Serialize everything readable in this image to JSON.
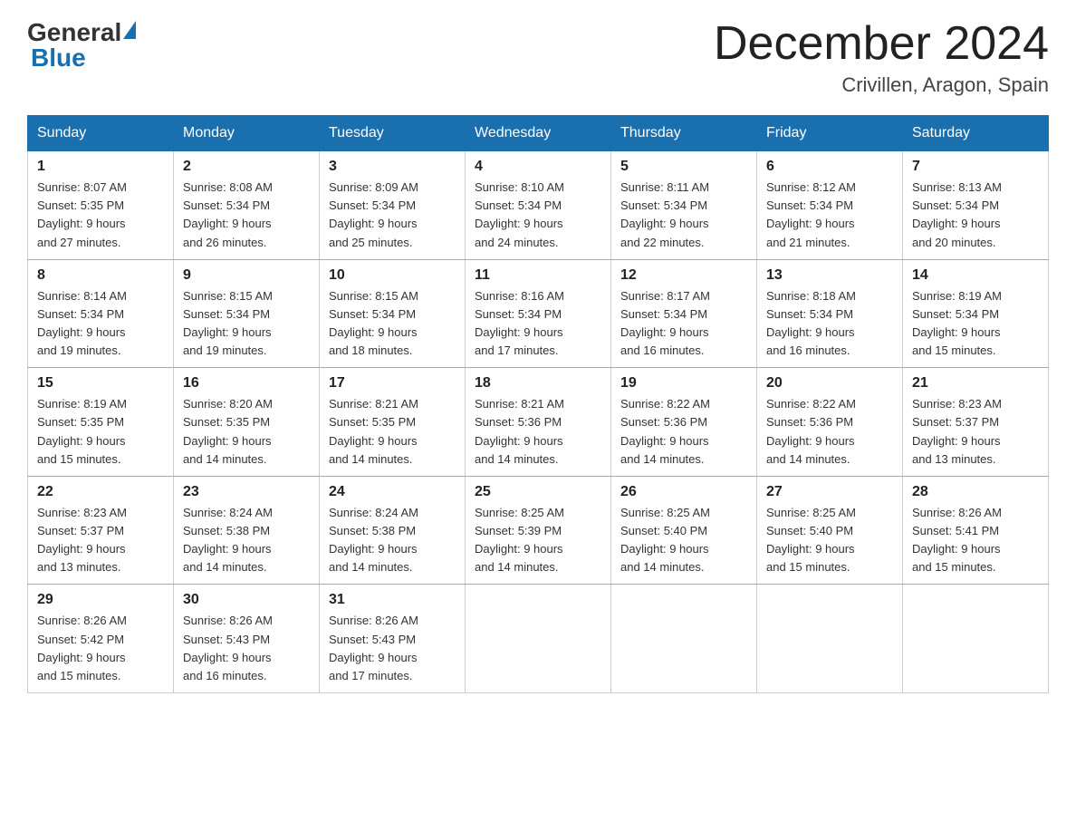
{
  "header": {
    "logo_general": "General",
    "logo_blue": "Blue",
    "month_title": "December 2024",
    "location": "Crivillen, Aragon, Spain"
  },
  "weekdays": [
    "Sunday",
    "Monday",
    "Tuesday",
    "Wednesday",
    "Thursday",
    "Friday",
    "Saturday"
  ],
  "weeks": [
    [
      {
        "day": "1",
        "sunrise": "8:07 AM",
        "sunset": "5:35 PM",
        "daylight": "9 hours and 27 minutes."
      },
      {
        "day": "2",
        "sunrise": "8:08 AM",
        "sunset": "5:34 PM",
        "daylight": "9 hours and 26 minutes."
      },
      {
        "day": "3",
        "sunrise": "8:09 AM",
        "sunset": "5:34 PM",
        "daylight": "9 hours and 25 minutes."
      },
      {
        "day": "4",
        "sunrise": "8:10 AM",
        "sunset": "5:34 PM",
        "daylight": "9 hours and 24 minutes."
      },
      {
        "day": "5",
        "sunrise": "8:11 AM",
        "sunset": "5:34 PM",
        "daylight": "9 hours and 22 minutes."
      },
      {
        "day": "6",
        "sunrise": "8:12 AM",
        "sunset": "5:34 PM",
        "daylight": "9 hours and 21 minutes."
      },
      {
        "day": "7",
        "sunrise": "8:13 AM",
        "sunset": "5:34 PM",
        "daylight": "9 hours and 20 minutes."
      }
    ],
    [
      {
        "day": "8",
        "sunrise": "8:14 AM",
        "sunset": "5:34 PM",
        "daylight": "9 hours and 19 minutes."
      },
      {
        "day": "9",
        "sunrise": "8:15 AM",
        "sunset": "5:34 PM",
        "daylight": "9 hours and 19 minutes."
      },
      {
        "day": "10",
        "sunrise": "8:15 AM",
        "sunset": "5:34 PM",
        "daylight": "9 hours and 18 minutes."
      },
      {
        "day": "11",
        "sunrise": "8:16 AM",
        "sunset": "5:34 PM",
        "daylight": "9 hours and 17 minutes."
      },
      {
        "day": "12",
        "sunrise": "8:17 AM",
        "sunset": "5:34 PM",
        "daylight": "9 hours and 16 minutes."
      },
      {
        "day": "13",
        "sunrise": "8:18 AM",
        "sunset": "5:34 PM",
        "daylight": "9 hours and 16 minutes."
      },
      {
        "day": "14",
        "sunrise": "8:19 AM",
        "sunset": "5:34 PM",
        "daylight": "9 hours and 15 minutes."
      }
    ],
    [
      {
        "day": "15",
        "sunrise": "8:19 AM",
        "sunset": "5:35 PM",
        "daylight": "9 hours and 15 minutes."
      },
      {
        "day": "16",
        "sunrise": "8:20 AM",
        "sunset": "5:35 PM",
        "daylight": "9 hours and 14 minutes."
      },
      {
        "day": "17",
        "sunrise": "8:21 AM",
        "sunset": "5:35 PM",
        "daylight": "9 hours and 14 minutes."
      },
      {
        "day": "18",
        "sunrise": "8:21 AM",
        "sunset": "5:36 PM",
        "daylight": "9 hours and 14 minutes."
      },
      {
        "day": "19",
        "sunrise": "8:22 AM",
        "sunset": "5:36 PM",
        "daylight": "9 hours and 14 minutes."
      },
      {
        "day": "20",
        "sunrise": "8:22 AM",
        "sunset": "5:36 PM",
        "daylight": "9 hours and 14 minutes."
      },
      {
        "day": "21",
        "sunrise": "8:23 AM",
        "sunset": "5:37 PM",
        "daylight": "9 hours and 13 minutes."
      }
    ],
    [
      {
        "day": "22",
        "sunrise": "8:23 AM",
        "sunset": "5:37 PM",
        "daylight": "9 hours and 13 minutes."
      },
      {
        "day": "23",
        "sunrise": "8:24 AM",
        "sunset": "5:38 PM",
        "daylight": "9 hours and 14 minutes."
      },
      {
        "day": "24",
        "sunrise": "8:24 AM",
        "sunset": "5:38 PM",
        "daylight": "9 hours and 14 minutes."
      },
      {
        "day": "25",
        "sunrise": "8:25 AM",
        "sunset": "5:39 PM",
        "daylight": "9 hours and 14 minutes."
      },
      {
        "day": "26",
        "sunrise": "8:25 AM",
        "sunset": "5:40 PM",
        "daylight": "9 hours and 14 minutes."
      },
      {
        "day": "27",
        "sunrise": "8:25 AM",
        "sunset": "5:40 PM",
        "daylight": "9 hours and 15 minutes."
      },
      {
        "day": "28",
        "sunrise": "8:26 AM",
        "sunset": "5:41 PM",
        "daylight": "9 hours and 15 minutes."
      }
    ],
    [
      {
        "day": "29",
        "sunrise": "8:26 AM",
        "sunset": "5:42 PM",
        "daylight": "9 hours and 15 minutes."
      },
      {
        "day": "30",
        "sunrise": "8:26 AM",
        "sunset": "5:43 PM",
        "daylight": "9 hours and 16 minutes."
      },
      {
        "day": "31",
        "sunrise": "8:26 AM",
        "sunset": "5:43 PM",
        "daylight": "9 hours and 17 minutes."
      },
      null,
      null,
      null,
      null
    ]
  ],
  "labels": {
    "sunrise": "Sunrise:",
    "sunset": "Sunset:",
    "daylight": "Daylight:"
  },
  "colors": {
    "header_bg": "#1a6faf",
    "border": "#aaa"
  }
}
